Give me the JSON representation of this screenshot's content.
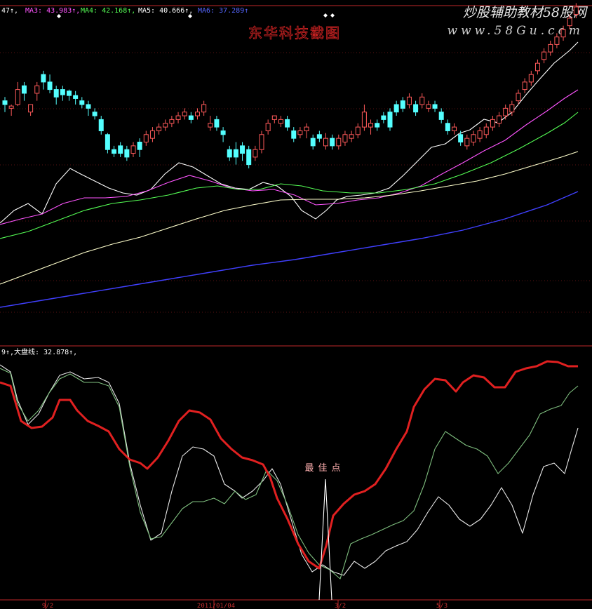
{
  "header": {
    "ma_items": [
      {
        "label": "47",
        "color": "#ffffff"
      },
      {
        "label": "MA3: 43.983",
        "color": "#ff55ff"
      },
      {
        "label": "MA4: 42.168",
        "color": "#55ff55"
      },
      {
        "label": "MA5: 40.666",
        "color": "#ffffff"
      },
      {
        "label": "MA6: 37.289",
        "color": "#5566ff"
      }
    ],
    "arrow": "↑"
  },
  "watermark": {
    "brand": "炒股辅助教材58股网",
    "url": "www.58Gu.com",
    "center_title": "东华科技截图"
  },
  "indicator_header": {
    "prefix": "9",
    "label": "大盘线: 32.878",
    "arrow": "↑",
    "trail": ","
  },
  "annotation": {
    "text": "最佳点"
  },
  "x_axis": {
    "labels": [
      "9/2",
      "2011/01/04",
      "3/2",
      "5/3"
    ]
  },
  "colors": {
    "background": "#000000",
    "panel_border": "#c0282a",
    "up": "#ff5a5a",
    "down": "#54ffff",
    "ma1": "#ffffff",
    "ma2": "#ff55ff",
    "ma3": "#55ff55",
    "ma4": "#ffffcc",
    "ma5": "#4040ff",
    "big_line": "#e02020"
  },
  "chart_data": [
    {
      "type": "candlestick",
      "title": "",
      "series": [
        {
          "name": "MA3",
          "value": 43.983
        },
        {
          "name": "MA4",
          "value": 42.168
        },
        {
          "name": "MA5",
          "value": 40.666
        },
        {
          "name": "MA6",
          "value": 37.289
        }
      ],
      "candles": [
        [
          305,
          300,
          290,
          310
        ],
        [
          295,
          298,
          285,
          300
        ],
        [
          300,
          320,
          298,
          330
        ],
        [
          325,
          315,
          305,
          330
        ],
        [
          290,
          300,
          285,
          300
        ],
        [
          315,
          325,
          305,
          330
        ],
        [
          340,
          330,
          320,
          345
        ],
        [
          330,
          320,
          315,
          340
        ],
        [
          320,
          310,
          300,
          325
        ],
        [
          320,
          313,
          305,
          325
        ],
        [
          318,
          312,
          305,
          320
        ],
        [
          312,
          308,
          300,
          318
        ],
        [
          305,
          300,
          295,
          310
        ],
        [
          300,
          295,
          285,
          305
        ],
        [
          290,
          285,
          280,
          295
        ],
        [
          280,
          265,
          260,
          285
        ],
        [
          260,
          240,
          235,
          262
        ],
        [
          240,
          235,
          230,
          245
        ],
        [
          245,
          235,
          230,
          250
        ],
        [
          240,
          230,
          225,
          245
        ],
        [
          235,
          245,
          230,
          250
        ],
        [
          250,
          240,
          230,
          255
        ],
        [
          250,
          260,
          245,
          265
        ],
        [
          255,
          265,
          250,
          270
        ],
        [
          265,
          270,
          260,
          275
        ],
        [
          270,
          275,
          265,
          280
        ],
        [
          275,
          280,
          270,
          285
        ],
        [
          280,
          285,
          275,
          290
        ],
        [
          285,
          290,
          280,
          295
        ],
        [
          285,
          280,
          275,
          290
        ],
        [
          285,
          290,
          280,
          295
        ],
        [
          290,
          300,
          285,
          305
        ],
        [
          270,
          275,
          265,
          285
        ],
        [
          280,
          270,
          265,
          285
        ],
        [
          265,
          260,
          250,
          270
        ],
        [
          240,
          230,
          225,
          245
        ],
        [
          240,
          230,
          220,
          250
        ],
        [
          245,
          235,
          225,
          250
        ],
        [
          240,
          220,
          215,
          245
        ],
        [
          230,
          240,
          225,
          245
        ],
        [
          240,
          260,
          235,
          265
        ],
        [
          265,
          275,
          260,
          280
        ],
        [
          280,
          285,
          275,
          285
        ],
        [
          275,
          280,
          270,
          285
        ],
        [
          280,
          270,
          265,
          285
        ],
        [
          265,
          255,
          250,
          270
        ],
        [
          260,
          265,
          255,
          270
        ],
        [
          265,
          270,
          255,
          275
        ],
        [
          255,
          245,
          240,
          260
        ],
        [
          260,
          255,
          250,
          265
        ],
        [
          245,
          255,
          240,
          262
        ],
        [
          255,
          245,
          240,
          260
        ],
        [
          245,
          255,
          240,
          260
        ],
        [
          250,
          260,
          245,
          265
        ],
        [
          255,
          260,
          250,
          265
        ],
        [
          260,
          270,
          255,
          275
        ],
        [
          270,
          290,
          265,
          300
        ],
        [
          270,
          275,
          260,
          280
        ],
        [
          275,
          270,
          265,
          280
        ],
        [
          285,
          280,
          275,
          290
        ],
        [
          290,
          270,
          265,
          295
        ],
        [
          300,
          290,
          285,
          305
        ],
        [
          305,
          295,
          290,
          310
        ],
        [
          300,
          310,
          295,
          315
        ],
        [
          300,
          290,
          285,
          305
        ],
        [
          300,
          310,
          295,
          315
        ],
        [
          295,
          300,
          290,
          305
        ],
        [
          300,
          295,
          290,
          305
        ],
        [
          290,
          280,
          275,
          295
        ],
        [
          275,
          265,
          260,
          280
        ],
        [
          265,
          270,
          260,
          275
        ],
        [
          260,
          250,
          245,
          265
        ],
        [
          245,
          255,
          240,
          260
        ],
        [
          250,
          260,
          245,
          265
        ],
        [
          255,
          265,
          250,
          270
        ],
        [
          260,
          270,
          255,
          275
        ],
        [
          270,
          280,
          265,
          285
        ],
        [
          275,
          285,
          270,
          290
        ],
        [
          285,
          295,
          280,
          300
        ],
        [
          290,
          300,
          285,
          305
        ],
        [
          305,
          315,
          300,
          320
        ],
        [
          320,
          330,
          315,
          335
        ],
        [
          330,
          340,
          325,
          345
        ],
        [
          345,
          355,
          340,
          360
        ],
        [
          360,
          370,
          355,
          375
        ],
        [
          370,
          380,
          365,
          385
        ],
        [
          380,
          390,
          375,
          395
        ],
        [
          390,
          400,
          385,
          405
        ],
        [
          405,
          415,
          400,
          420
        ],
        [
          420,
          430,
          415,
          435
        ]
      ]
    },
    {
      "type": "line",
      "title": "",
      "series": [
        {
          "name": "大盘线",
          "value": 32.878
        }
      ]
    }
  ]
}
